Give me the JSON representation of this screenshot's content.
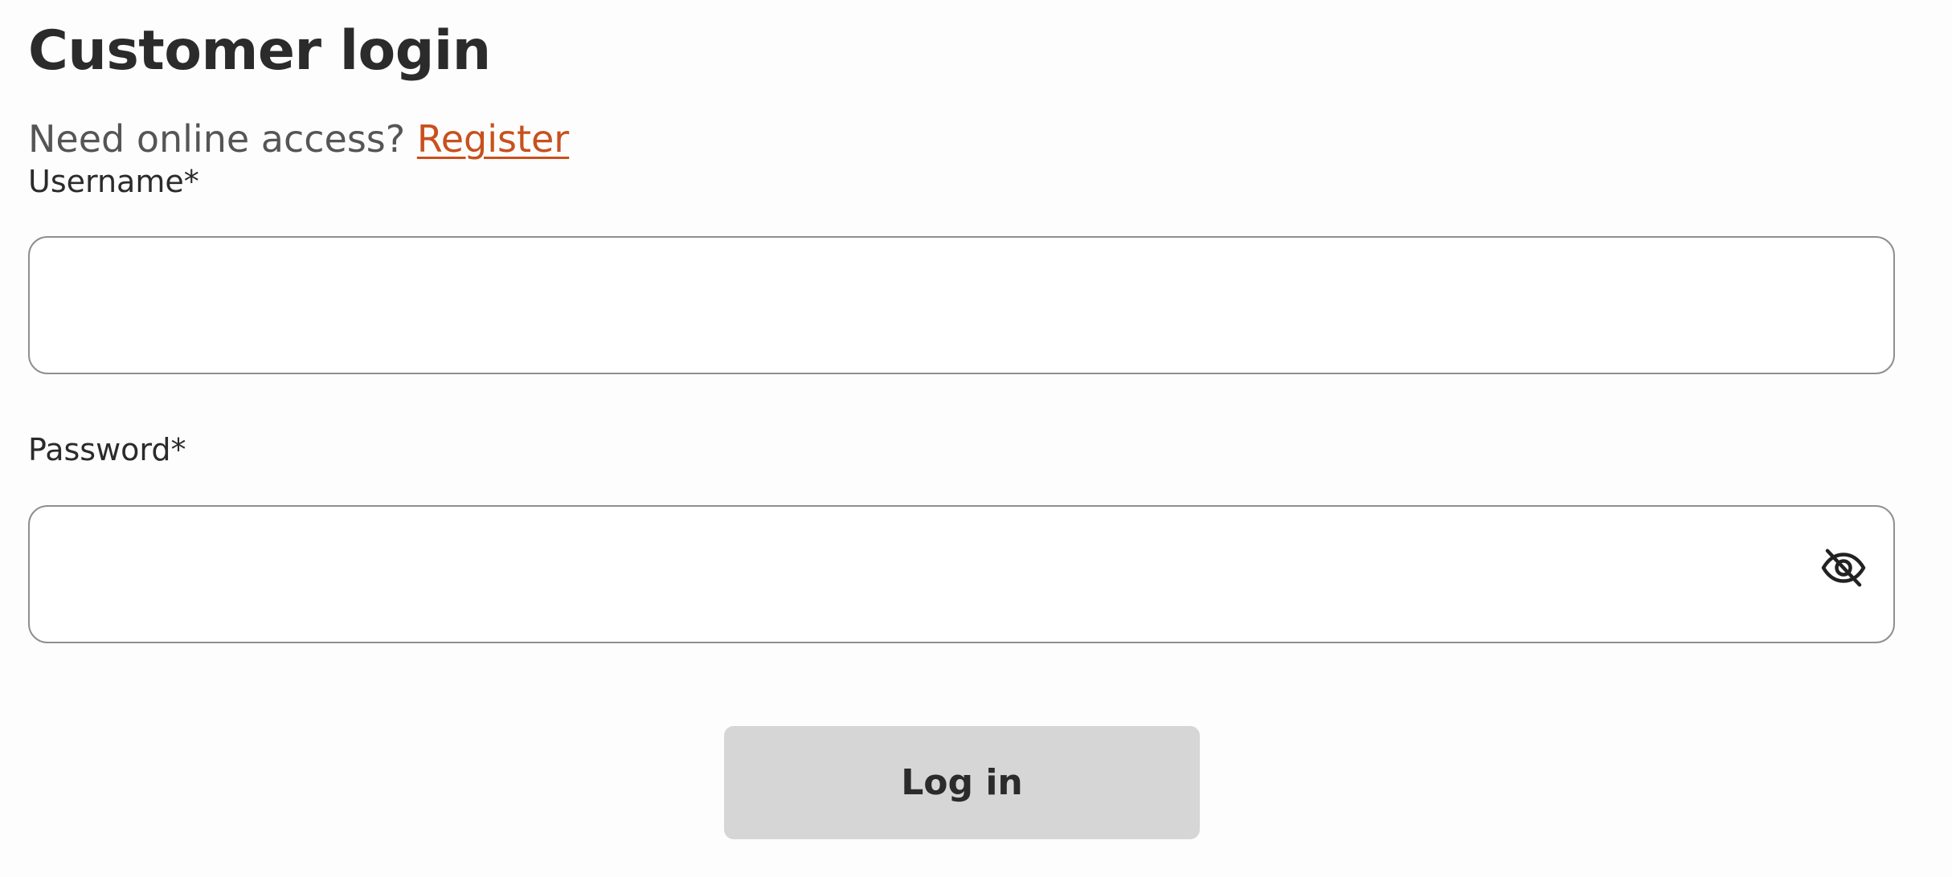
{
  "form": {
    "title": "Customer login",
    "access_prompt": "Need online access?",
    "register_link": "Register",
    "username": {
      "label": "Username*",
      "value": "",
      "placeholder": ""
    },
    "password": {
      "label": "Password*",
      "value": "",
      "placeholder": "",
      "toggle_icon": "eye-slash-icon"
    },
    "login_button": "Log in"
  },
  "colors": {
    "text": "#2b2b2b",
    "muted_text": "#555555",
    "link": "#c8501d",
    "input_border": "#8f8f8f",
    "button_bg": "#d6d6d6",
    "page_bg": "#fdfdfd"
  }
}
